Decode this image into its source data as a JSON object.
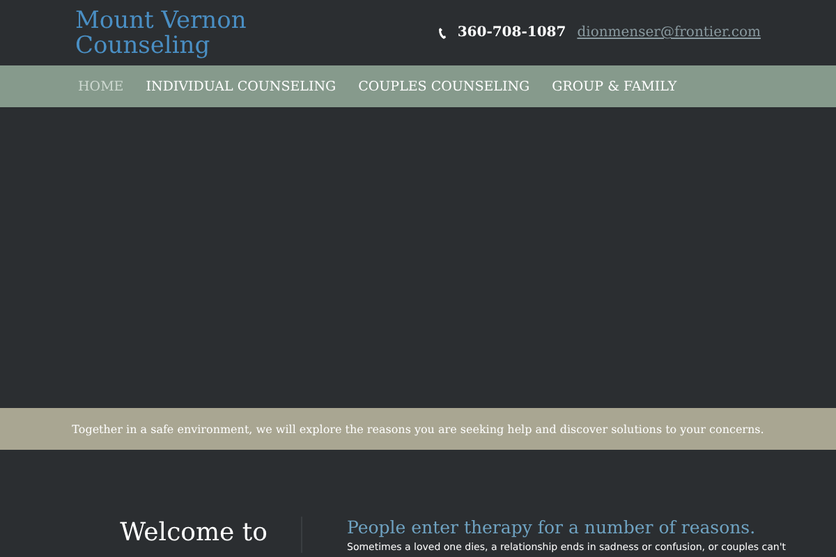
{
  "site": {
    "title_line1": "Mount Vernon",
    "title_line2": "Counseling",
    "phone": "360-708-1087",
    "email": "dionmenser@frontier.com"
  },
  "nav": [
    {
      "label": "HOME",
      "selected": true
    },
    {
      "label": "INDIVIDUAL COUNSELING",
      "selected": false
    },
    {
      "label": "COUPLES COUNSELING",
      "selected": false
    },
    {
      "label": "GROUP & FAMILY",
      "selected": false
    }
  ],
  "banner": "Together in a safe environment, we will explore the reasons you are seeking help and discover solutions to your concerns.",
  "welcome": {
    "line1": "Welcome to"
  },
  "intro": {
    "heading": "People enter therapy for a number of reasons.",
    "body": "Sometimes a loved one dies, a relationship ends in sadness or confusion, or couples can't"
  }
}
